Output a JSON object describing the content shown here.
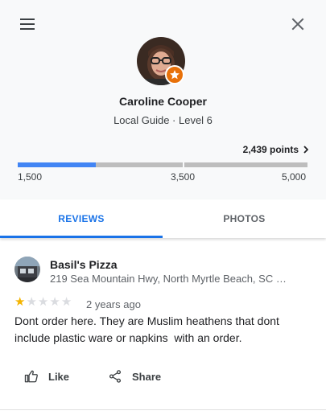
{
  "header": {
    "menu_icon": "hamburger-menu-icon",
    "close_icon": "close-icon"
  },
  "profile": {
    "name": "Caroline Cooper",
    "level_text": "Local Guide · Level 6",
    "badge_icon": "local-guide-star-icon",
    "points_label": "2,439 points",
    "points_value": 2439,
    "progress_min": 1500,
    "progress_max": 5000,
    "ticks": [
      "1,500",
      "3,500",
      "5,000"
    ],
    "colors": {
      "progress_fill": "#4285f4",
      "badge": "#e8710a"
    }
  },
  "tabs": [
    {
      "label": "REVIEWS",
      "selected": true
    },
    {
      "label": "PHOTOS",
      "selected": false
    }
  ],
  "review": {
    "place_name": "Basil's Pizza",
    "place_address": "219 Sea Mountain Hwy, North Myrtle Beach, SC …",
    "rating": 1,
    "max_rating": 5,
    "date": "2 years ago",
    "text": "Dont order here. They are Muslim heathens that dont include plastic ware or napkins  with an order.",
    "like_label": "Like",
    "share_label": "Share",
    "like_icon": "thumbs-up-icon",
    "share_icon": "share-icon",
    "star_color": "#f4b400"
  }
}
